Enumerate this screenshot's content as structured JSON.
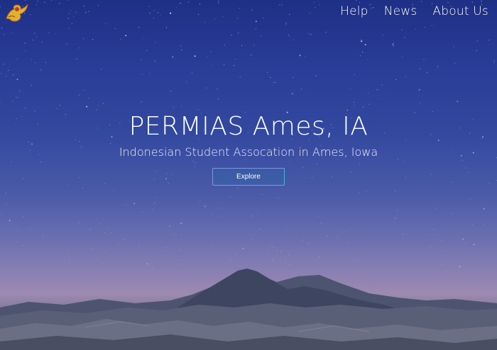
{
  "brand": {
    "logo_icon": "garuda-bird-logo-icon"
  },
  "nav": {
    "items": [
      {
        "label": "Help"
      },
      {
        "label": "News"
      },
      {
        "label": "About Us"
      }
    ]
  },
  "hero": {
    "title": "PERMIAS Ames, IA",
    "subtitle": "Indonesian Student Assocation in Ames, Iowa",
    "button_label": "Explore",
    "background": "starry-night-mountain-landscape"
  },
  "colors": {
    "sky_top": "#1e2f86",
    "sky_mid": "#33489f",
    "horizon": "#9d8ab0",
    "button_border": "#4bb3d6",
    "text": "#ffffff"
  }
}
